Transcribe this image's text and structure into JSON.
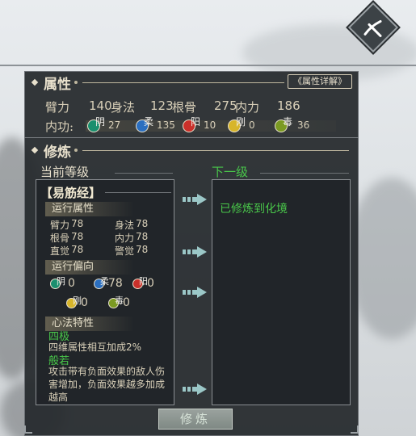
{
  "attributes_section": {
    "title": "属性",
    "detail_button": "《属性详解》",
    "stats": [
      {
        "label": "臂力",
        "value": "140"
      },
      {
        "label": "身法",
        "value": "123"
      },
      {
        "label": "根骨",
        "value": "275"
      },
      {
        "label": "内力",
        "value": "186"
      }
    ],
    "neili_label": "内功:",
    "neili": [
      {
        "glyph": "阴",
        "value": "27",
        "color": "#1a8f6e"
      },
      {
        "glyph": "柔",
        "value": "135",
        "color": "#2b6fc0"
      },
      {
        "glyph": "阳",
        "value": "10",
        "color": "#c9302a"
      },
      {
        "glyph": "刚",
        "value": "0",
        "color": "#d7b52a"
      },
      {
        "glyph": "毒",
        "value": "36",
        "color": "#7b9a22"
      }
    ]
  },
  "cultivation_section": {
    "title": "修炼",
    "current_label": "当前等级",
    "next_label": "下一级",
    "skill_name": "【易筋经】",
    "run_attrs_title": "运行属性",
    "run_attrs": [
      {
        "label": "臂力",
        "value": "78"
      },
      {
        "label": "身法",
        "value": "78"
      },
      {
        "label": "根骨",
        "value": "78"
      },
      {
        "label": "内力",
        "value": "78"
      },
      {
        "label": "直觉",
        "value": "78"
      },
      {
        "label": "警觉",
        "value": "78"
      }
    ],
    "run_bias_title": "运行偏向",
    "run_bias": [
      {
        "glyph": "阴",
        "value": "0",
        "color": "#1a8f6e"
      },
      {
        "glyph": "柔",
        "value": "78",
        "color": "#2b6fc0"
      },
      {
        "glyph": "阳",
        "value": "0",
        "color": "#c9302a"
      },
      {
        "glyph": "刚",
        "value": "0",
        "color": "#d7b52a"
      },
      {
        "glyph": "毒",
        "value": "0",
        "color": "#7b9a22"
      }
    ],
    "traits_title": "心法特性",
    "trait1_name": "四极",
    "trait1_desc": "四维属性相互加成2%",
    "trait2_name": "般若",
    "trait2_desc": "攻击带有负面效果的敌人伤害增加，负面效果越多加成越高",
    "next_level_text": "已修炼到化境",
    "cultivate_button": "修炼"
  }
}
